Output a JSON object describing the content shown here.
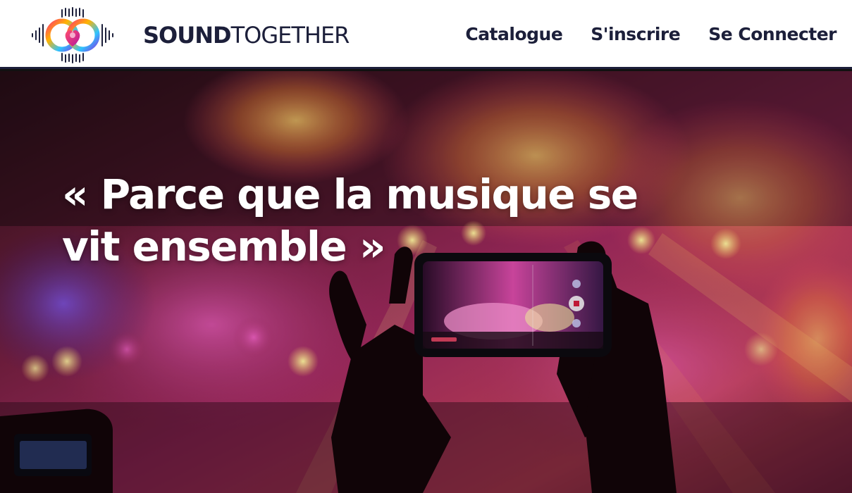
{
  "header": {
    "brand_bold": "SOUND",
    "brand_light": "TOGETHER",
    "logo_icon": "soundwave-heart-logo",
    "nav": [
      {
        "label": "Catalogue"
      },
      {
        "label": "S'inscrire"
      },
      {
        "label": "Se Connecter"
      }
    ]
  },
  "hero": {
    "tagline": "« Parce que la musique se vit ensemble »",
    "background": "concert-crowd-phone-photo"
  },
  "colors": {
    "navy": "#1c1f3a",
    "white": "#ffffff"
  }
}
